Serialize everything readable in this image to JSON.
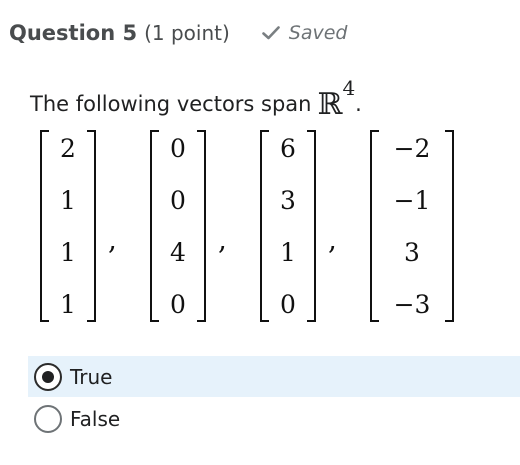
{
  "question": {
    "title": "Question 5",
    "points": "(1 point)",
    "saved_label": "Saved",
    "check_icon": "check-icon",
    "prompt_text": "The following vectors span",
    "space_symbol": "ℝ",
    "space_dim": "4",
    "prompt_end": "."
  },
  "vectors": [
    [
      "2",
      "1",
      "1",
      "1"
    ],
    [
      "0",
      "0",
      "4",
      "0"
    ],
    [
      "6",
      "3",
      "1",
      "0"
    ],
    [
      "−2",
      "−1",
      "3",
      "−3"
    ]
  ],
  "comma": ",",
  "options": [
    {
      "label": "True",
      "selected": true
    },
    {
      "label": "False",
      "selected": false
    }
  ],
  "colors": {
    "selected_bg": "#e6f2fb",
    "text": "#202122",
    "muted": "#6e7376"
  }
}
